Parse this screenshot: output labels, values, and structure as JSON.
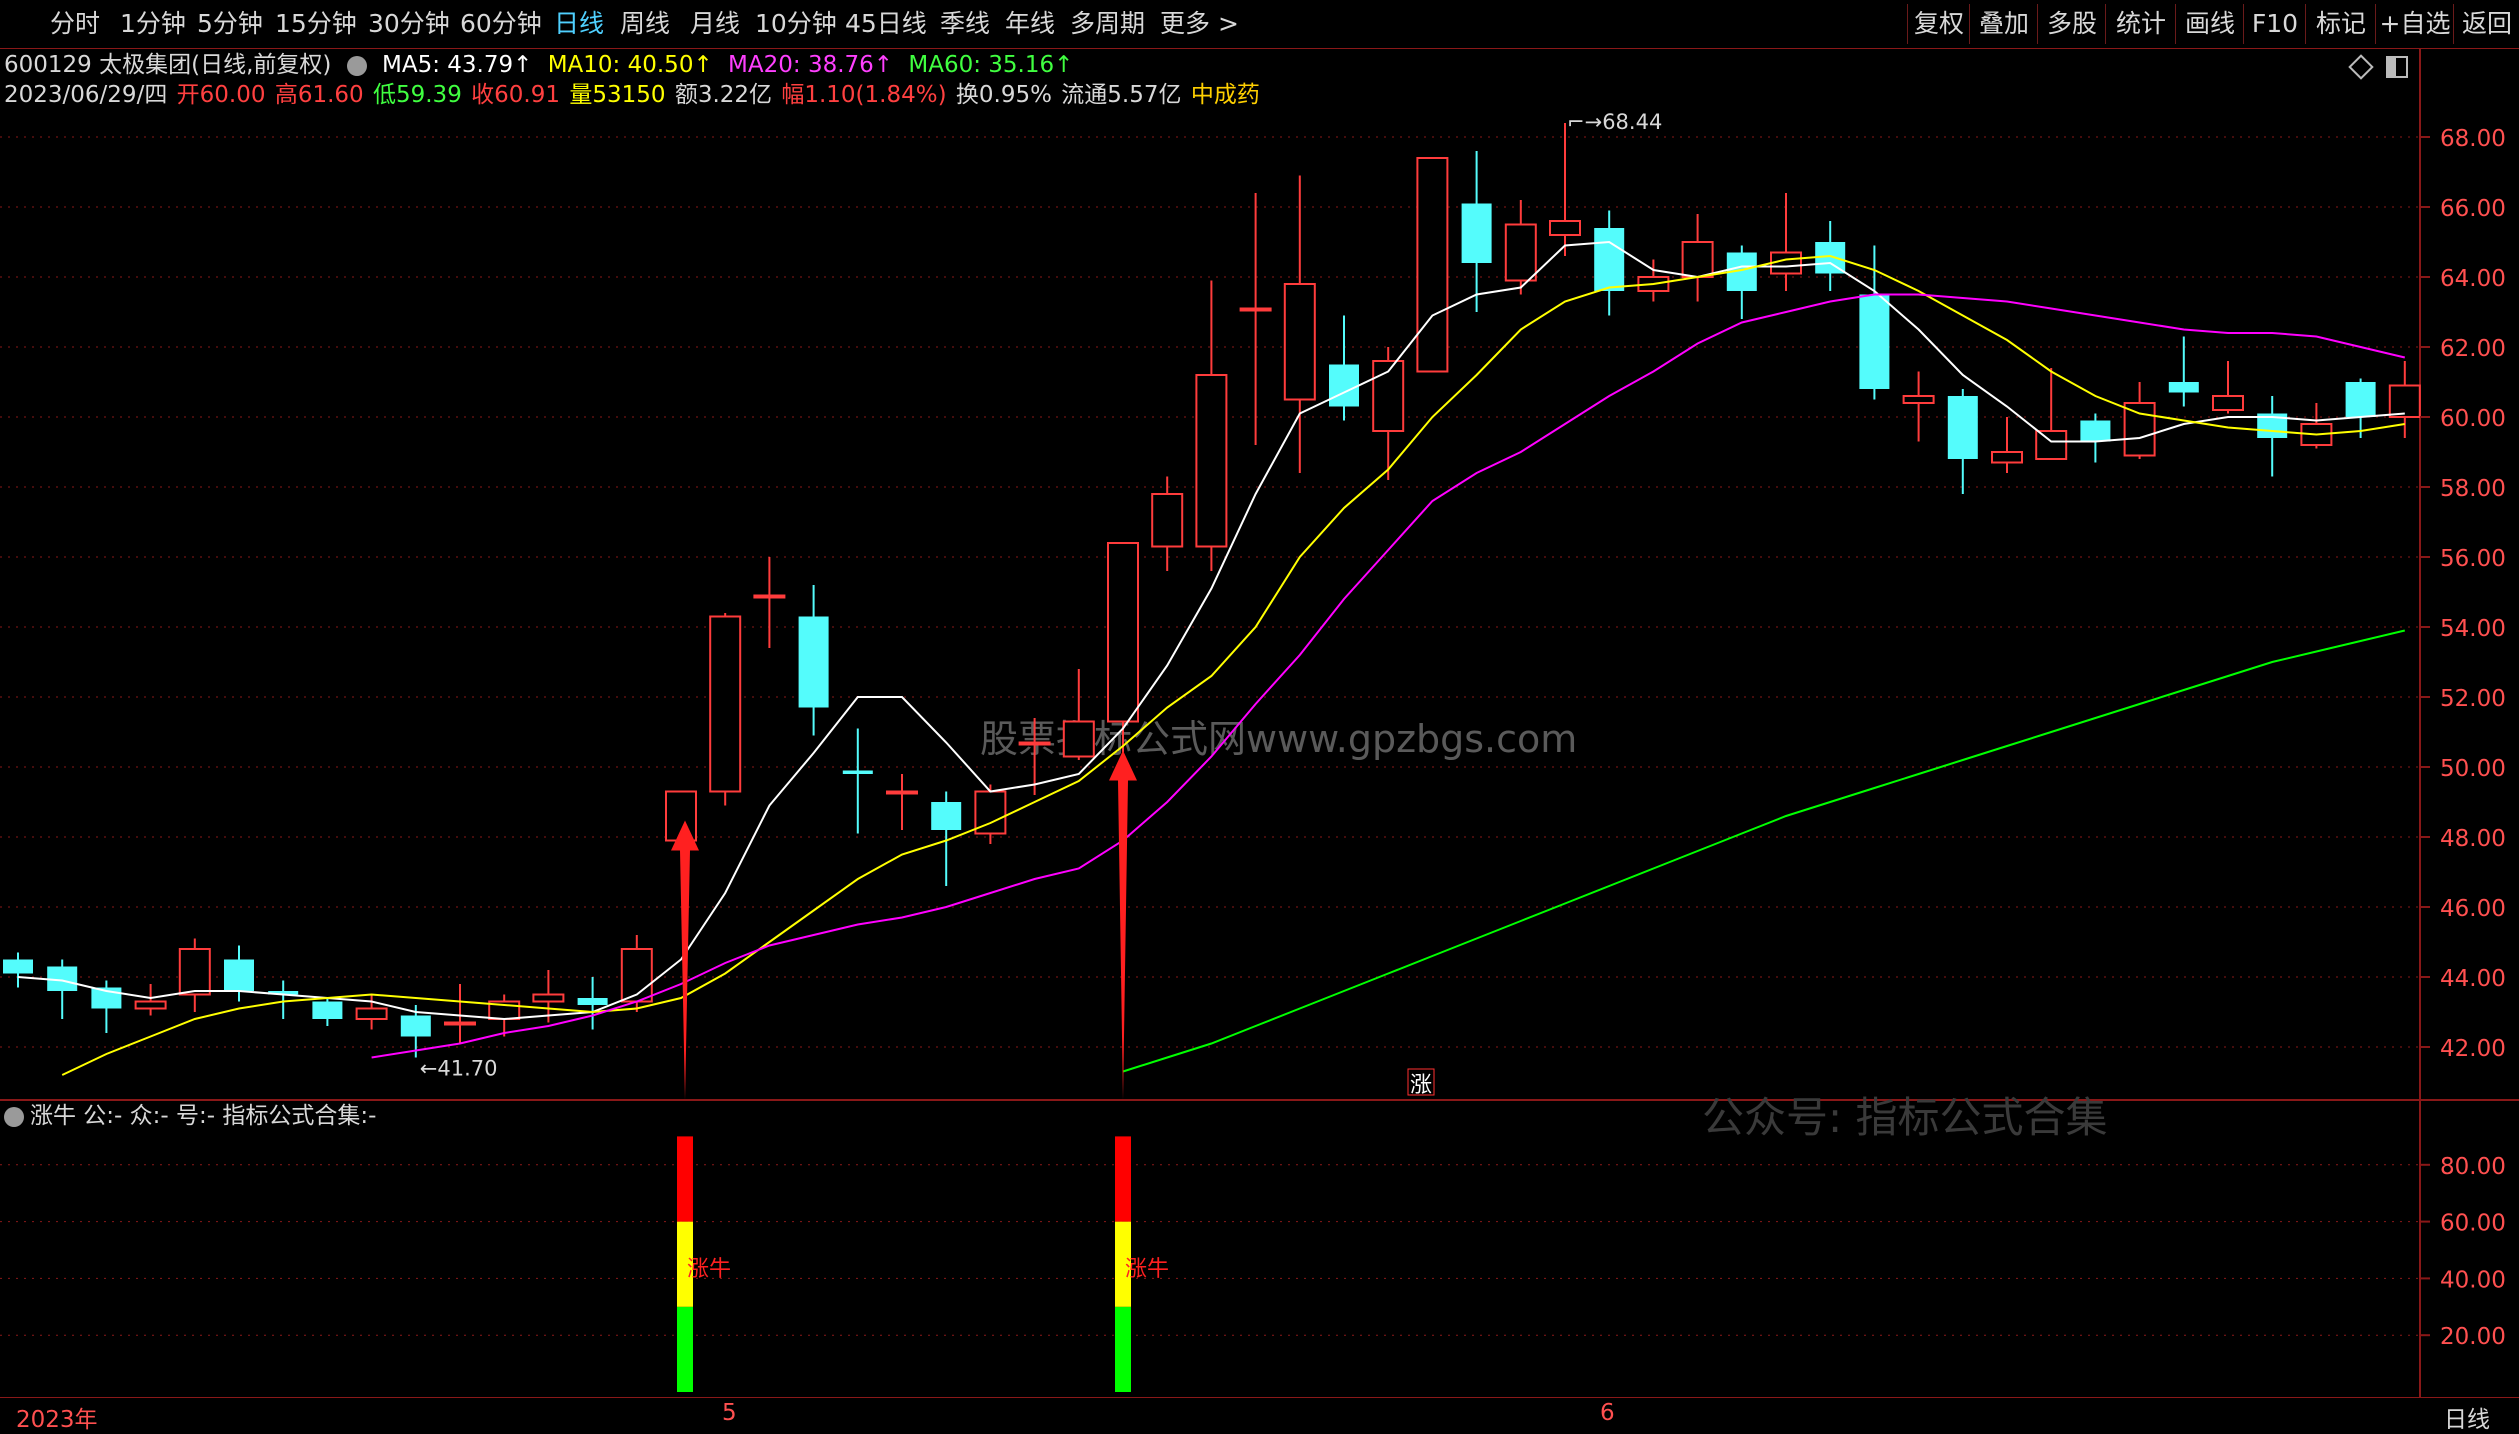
{
  "toolbar": {
    "periods": [
      "分时",
      "1分钟",
      "5分钟",
      "15分钟",
      "30分钟",
      "60分钟",
      "日线",
      "周线",
      "月线",
      "10分钟",
      "45日线",
      "季线",
      "年线",
      "多周期",
      "更多 >"
    ],
    "active_period": "日线",
    "right_buttons": [
      "复权",
      "叠加",
      "多股",
      "统计",
      "画线",
      "F10",
      "标记",
      "+自选",
      "返回"
    ]
  },
  "header": {
    "stock": "600129 太极集团(日线,前复权)",
    "ma5": "MA5: 43.79↑",
    "ma10": "MA10: 40.50↑",
    "ma20": "MA20: 38.76↑",
    "ma60": "MA60: 35.16↑",
    "date": "2023/06/29/四",
    "open": "开60.00",
    "high": "高61.60",
    "low": "低59.39",
    "close": "收60.91",
    "volume": "量53150",
    "amount": "额3.22亿",
    "amp": "幅1.10(1.84%)",
    "turnover": "换0.95%",
    "float": "流通5.57亿",
    "sector": "中成药"
  },
  "indicator": {
    "title": "涨牛  公:-  众:-  号:-  指标公式合集:-",
    "signal_label": "涨牛",
    "watermark_main": "股票指标公式网www.gpzbgs.com",
    "watermark_sub": "公众号: 指标公式合集",
    "zhang_label": "涨"
  },
  "bottom": {
    "year_label": "2023年",
    "month_5": "5",
    "month_6": "6",
    "period_label": "日线"
  },
  "colors": {
    "up": "#ff3c3c",
    "down": "#54fcfc",
    "ma5": "#ffffff",
    "ma10": "#ffff00",
    "ma20": "#ff00ff",
    "ma60": "#00ff00",
    "grid": "#8a1818"
  },
  "chart_data": [
    {
      "type": "candlestick",
      "y_ticks": [
        "68.00",
        "66.00",
        "64.00",
        "62.00",
        "60.00",
        "58.00",
        "56.00",
        "54.00",
        "52.00",
        "50.00",
        "48.00",
        "46.00",
        "44.00",
        "42.00"
      ],
      "ylim": [
        41.0,
        69.0
      ],
      "high_label": "68.44",
      "low_label": "41.70",
      "candles": [
        {
          "o": 44.5,
          "c": 44.1,
          "h": 44.7,
          "l": 43.7
        },
        {
          "o": 44.3,
          "c": 43.6,
          "h": 44.5,
          "l": 42.8
        },
        {
          "o": 43.7,
          "c": 43.1,
          "h": 43.9,
          "l": 42.4
        },
        {
          "o": 43.1,
          "c": 43.3,
          "h": 43.8,
          "l": 42.9
        },
        {
          "o": 43.5,
          "c": 44.8,
          "h": 45.1,
          "l": 43.0
        },
        {
          "o": 44.5,
          "c": 43.6,
          "h": 44.9,
          "l": 43.3
        },
        {
          "o": 43.6,
          "c": 43.5,
          "h": 43.9,
          "l": 42.8
        },
        {
          "o": 43.3,
          "c": 42.8,
          "h": 43.4,
          "l": 42.6
        },
        {
          "o": 42.8,
          "c": 43.1,
          "h": 43.5,
          "l": 42.5
        },
        {
          "o": 42.9,
          "c": 42.3,
          "h": 43.2,
          "l": 41.7
        },
        {
          "o": 42.7,
          "c": 42.7,
          "h": 43.8,
          "l": 42.1
        },
        {
          "o": 42.8,
          "c": 43.3,
          "h": 43.5,
          "l": 42.3
        },
        {
          "o": 43.3,
          "c": 43.5,
          "h": 44.2,
          "l": 42.7
        },
        {
          "o": 43.4,
          "c": 43.2,
          "h": 44.0,
          "l": 42.5
        },
        {
          "o": 43.3,
          "c": 44.8,
          "h": 45.2,
          "l": 43.0
        },
        {
          "o": 47.9,
          "c": 49.3,
          "h": 49.3,
          "l": 47.9
        },
        {
          "o": 49.3,
          "c": 54.3,
          "h": 54.4,
          "l": 48.9
        },
        {
          "o": 54.9,
          "c": 54.9,
          "h": 56.0,
          "l": 53.4
        },
        {
          "o": 54.3,
          "c": 51.7,
          "h": 55.2,
          "l": 50.9
        },
        {
          "o": 49.9,
          "c": 49.8,
          "h": 51.1,
          "l": 48.1
        },
        {
          "o": 49.3,
          "c": 49.3,
          "h": 49.8,
          "l": 48.2
        },
        {
          "o": 49.0,
          "c": 48.2,
          "h": 49.3,
          "l": 46.6
        },
        {
          "o": 48.1,
          "c": 49.3,
          "h": 49.5,
          "l": 47.8
        },
        {
          "o": 50.7,
          "c": 50.7,
          "h": 51.4,
          "l": 49.2
        },
        {
          "o": 50.3,
          "c": 51.3,
          "h": 52.8,
          "l": 50.2
        },
        {
          "o": 51.3,
          "c": 56.4,
          "h": 56.4,
          "l": 49.9
        },
        {
          "o": 56.3,
          "c": 57.8,
          "h": 58.3,
          "l": 55.6
        },
        {
          "o": 56.3,
          "c": 61.2,
          "h": 63.9,
          "l": 55.6
        },
        {
          "o": 63.1,
          "c": 63.1,
          "h": 66.4,
          "l": 59.2
        },
        {
          "o": 60.5,
          "c": 63.8,
          "h": 66.9,
          "l": 58.4
        },
        {
          "o": 61.5,
          "c": 60.3,
          "h": 62.9,
          "l": 59.9
        },
        {
          "o": 59.6,
          "c": 61.6,
          "h": 62.0,
          "l": 58.2
        },
        {
          "o": 61.3,
          "c": 67.4,
          "h": 67.4,
          "l": 61.3
        },
        {
          "o": 66.1,
          "c": 64.4,
          "h": 67.6,
          "l": 63.0
        },
        {
          "o": 63.9,
          "c": 65.5,
          "h": 66.2,
          "l": 63.5
        },
        {
          "o": 65.2,
          "c": 65.6,
          "h": 68.4,
          "l": 64.6
        },
        {
          "o": 65.4,
          "c": 63.6,
          "h": 65.9,
          "l": 62.9
        },
        {
          "o": 63.6,
          "c": 64.0,
          "h": 64.5,
          "l": 63.3
        },
        {
          "o": 64.0,
          "c": 65.0,
          "h": 65.8,
          "l": 63.3
        },
        {
          "o": 64.7,
          "c": 63.6,
          "h": 64.9,
          "l": 62.8
        },
        {
          "o": 64.1,
          "c": 64.7,
          "h": 66.4,
          "l": 63.6
        },
        {
          "o": 65.0,
          "c": 64.1,
          "h": 65.6,
          "l": 63.6
        },
        {
          "o": 63.5,
          "c": 60.8,
          "h": 64.9,
          "l": 60.5
        },
        {
          "o": 60.4,
          "c": 60.6,
          "h": 61.3,
          "l": 59.3
        },
        {
          "o": 60.6,
          "c": 58.8,
          "h": 60.8,
          "l": 57.8
        },
        {
          "o": 58.7,
          "c": 59.0,
          "h": 60.0,
          "l": 58.4
        },
        {
          "o": 58.8,
          "c": 59.6,
          "h": 61.4,
          "l": 58.8
        },
        {
          "o": 59.9,
          "c": 59.3,
          "h": 60.1,
          "l": 58.7
        },
        {
          "o": 58.9,
          "c": 60.4,
          "h": 61.0,
          "l": 58.8
        },
        {
          "o": 61.0,
          "c": 60.7,
          "h": 62.3,
          "l": 60.3
        },
        {
          "o": 60.2,
          "c": 60.6,
          "h": 61.6,
          "l": 60.1
        },
        {
          "o": 60.1,
          "c": 59.4,
          "h": 60.6,
          "l": 58.3
        },
        {
          "o": 59.2,
          "c": 59.8,
          "h": 60.4,
          "l": 59.1
        },
        {
          "o": 61.0,
          "c": 60.0,
          "h": 61.1,
          "l": 59.4
        },
        {
          "o": 60.0,
          "c": 60.9,
          "h": 61.6,
          "l": 59.4
        }
      ],
      "ma5": [
        44.0,
        43.9,
        43.6,
        43.4,
        43.6,
        43.6,
        43.5,
        43.4,
        43.3,
        43.0,
        42.9,
        42.8,
        42.9,
        43.0,
        43.5,
        44.5,
        46.4,
        48.9,
        50.4,
        52.0,
        52.0,
        50.7,
        49.3,
        49.5,
        49.8,
        51.1,
        52.9,
        55.1,
        57.8,
        60.1,
        60.7,
        61.3,
        62.9,
        63.5,
        63.7,
        64.9,
        65.0,
        64.2,
        64.0,
        64.3,
        64.3,
        64.4,
        63.6,
        62.5,
        61.2,
        60.3,
        59.3,
        59.3,
        59.4,
        59.8,
        60.0,
        60.0,
        59.9,
        60.0,
        60.1
      ],
      "ma10": [
        null,
        41.2,
        41.8,
        42.3,
        42.8,
        43.1,
        43.3,
        43.4,
        43.5,
        43.4,
        43.3,
        43.2,
        43.1,
        43.0,
        43.1,
        43.4,
        44.1,
        45.0,
        45.9,
        46.8,
        47.5,
        47.9,
        48.4,
        49.0,
        49.6,
        50.6,
        51.7,
        52.6,
        54.0,
        56.0,
        57.4,
        58.5,
        60.0,
        61.2,
        62.5,
        63.3,
        63.7,
        63.8,
        64.0,
        64.2,
        64.5,
        64.6,
        64.2,
        63.6,
        62.9,
        62.2,
        61.3,
        60.6,
        60.1,
        59.9,
        59.7,
        59.6,
        59.5,
        59.6,
        59.8
      ],
      "ma20": [
        null,
        null,
        null,
        null,
        null,
        null,
        null,
        null,
        41.7,
        41.9,
        42.1,
        42.4,
        42.6,
        42.9,
        43.3,
        43.8,
        44.4,
        44.9,
        45.2,
        45.5,
        45.7,
        46.0,
        46.4,
        46.8,
        47.1,
        47.9,
        49.0,
        50.3,
        51.8,
        53.2,
        54.8,
        56.2,
        57.6,
        58.4,
        59.0,
        59.8,
        60.6,
        61.3,
        62.1,
        62.7,
        63.0,
        63.3,
        63.5,
        63.5,
        63.4,
        63.3,
        63.1,
        62.9,
        62.7,
        62.5,
        62.4,
        62.4,
        62.3,
        62.0,
        61.7
      ],
      "ma60": [
        null,
        null,
        null,
        null,
        null,
        null,
        null,
        null,
        null,
        null,
        null,
        null,
        null,
        null,
        null,
        null,
        null,
        null,
        null,
        null,
        null,
        null,
        null,
        null,
        null,
        41.3,
        41.7,
        42.1,
        42.6,
        43.1,
        43.6,
        44.1,
        44.6,
        45.1,
        45.6,
        46.1,
        46.6,
        47.1,
        47.6,
        48.1,
        48.6,
        49.0,
        49.4,
        49.8,
        50.2,
        50.6,
        51.0,
        51.4,
        51.8,
        52.2,
        52.6,
        53.0,
        53.3,
        53.6,
        53.9
      ],
      "signals": [
        15,
        25
      ]
    },
    {
      "type": "bar",
      "y_ticks": [
        "80.00",
        "60.00",
        "40.00",
        "20.00"
      ],
      "ylim": [
        0,
        100
      ],
      "signal_bars": [
        {
          "index": 15,
          "segments": [
            {
              "from": 0,
              "to": 30,
              "color": "#00ff00"
            },
            {
              "from": 30,
              "to": 60,
              "color": "#ffff00"
            },
            {
              "from": 60,
              "to": 90,
              "color": "#ff0000"
            }
          ]
        },
        {
          "index": 25,
          "segments": [
            {
              "from": 0,
              "to": 30,
              "color": "#00ff00"
            },
            {
              "from": 30,
              "to": 60,
              "color": "#ffff00"
            },
            {
              "from": 60,
              "to": 90,
              "color": "#ff0000"
            }
          ]
        }
      ]
    }
  ]
}
